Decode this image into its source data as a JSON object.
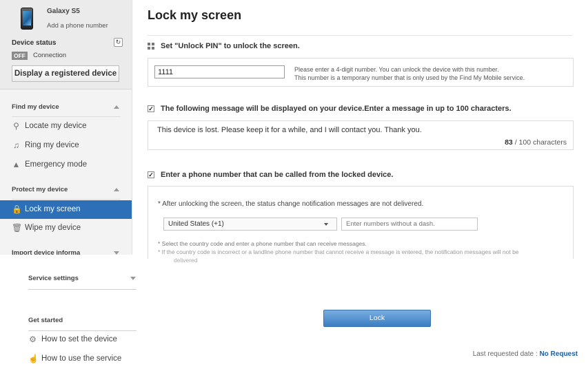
{
  "device": {
    "name": "Galaxy S5",
    "add_phone": "Add a phone number",
    "status_title": "Device status",
    "status_badge": "OFF",
    "status_text": "Connection",
    "register_btn": "Display a registered device"
  },
  "sidebar": {
    "find_title": "Find my device",
    "find_items": [
      {
        "label": "Locate my device",
        "icon": "search-icon"
      },
      {
        "label": "Ring my device",
        "icon": "music-note-icon"
      },
      {
        "label": "Emergency mode",
        "icon": "emergency-icon"
      }
    ],
    "protect_title": "Protect my device",
    "protect_items": [
      {
        "label": "Lock my screen",
        "icon": "lock-icon",
        "active": true
      },
      {
        "label": "Wipe my device",
        "icon": "trash-icon"
      }
    ],
    "import_title": "Import device informa",
    "service_title": "Service settings",
    "getstarted_title": "Get started",
    "getstarted_items": [
      {
        "label": "How to set the device",
        "icon": "gear-icon"
      },
      {
        "label": "How to use the service",
        "icon": "hand-pointer-icon"
      }
    ]
  },
  "main": {
    "title": "Lock my screen",
    "pin_label": "Set \"Unlock PIN\" to unlock the screen.",
    "pin_value": "1111",
    "pin_hint1": "Please enter a 4-digit number. You can unlock the device with this number.",
    "pin_hint2": "This number is a temporary number that is only used by the Find My Mobile service.",
    "msg_label": "The following message will be displayed on your device.Enter a message in up to 100 characters.",
    "msg_text": "This device is lost. Please keep it for a while, and I will contact you. Thank you.",
    "msg_count": "83",
    "msg_max": "/ 100 characters",
    "phone_label": "Enter a phone number that can be called from the locked device.",
    "phone_note": "* After unlocking the screen, the status change notification messages are not delivered.",
    "country": "United States (+1)",
    "phone_placeholder": "Enter numbers without a dash.",
    "fn1": "* Select the country code and enter a phone number that can receive messages.",
    "fn2": "* If the country code is incorrect or a landline phone number that cannot receive a message is entered, the notification messages will not be",
    "fn3": "delivered",
    "lock_btn": "Lock",
    "last_req_label": "Last requested date :",
    "last_req_value": "No Request"
  }
}
